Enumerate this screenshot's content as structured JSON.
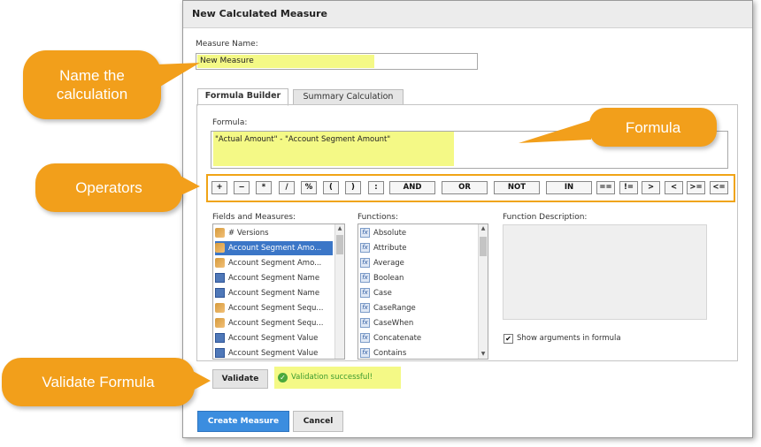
{
  "dialog": {
    "title": "New Calculated Measure",
    "measure_name_label": "Measure Name:",
    "measure_name_value": "New Measure",
    "tabs": [
      "Formula Builder",
      "Summary Calculation"
    ],
    "formula_label": "Formula:",
    "formula_value": "\"Actual Amount\" - \"Account Segment Amount\"",
    "operators": [
      "+",
      "−",
      "*",
      "/",
      "%",
      "(",
      ")",
      ":",
      "AND",
      "OR",
      "NOT",
      "IN",
      "==",
      "!=",
      ">",
      "<",
      ">=",
      "<="
    ],
    "fields_label": "Fields and Measures:",
    "fields": [
      {
        "label": "# Versions",
        "icon": "measure-icon"
      },
      {
        "label": "Account Segment Amo...",
        "icon": "measure-icon",
        "selected": true
      },
      {
        "label": "Account Segment Amo...",
        "icon": "measure-icon"
      },
      {
        "label": "Account Segment Name",
        "icon": "column-icon"
      },
      {
        "label": "Account Segment Name",
        "icon": "column-icon"
      },
      {
        "label": "Account Segment Sequ...",
        "icon": "measure-icon"
      },
      {
        "label": "Account Segment Sequ...",
        "icon": "measure-icon"
      },
      {
        "label": "Account Segment Value",
        "icon": "column-icon"
      },
      {
        "label": "Account Segment Value",
        "icon": "column-icon"
      }
    ],
    "functions_label": "Functions:",
    "functions": [
      "Absolute",
      "Attribute",
      "Average",
      "Boolean",
      "Case",
      "CaseRange",
      "CaseWhen",
      "Concatenate",
      "Contains"
    ],
    "function_description_label": "Function Description:",
    "show_arguments_label": "Show arguments in formula",
    "show_arguments_checked": true,
    "validate_label": "Validate",
    "validation_message": "Validation successful!",
    "create_label": "Create Measure",
    "cancel_label": "Cancel"
  },
  "callouts": {
    "name": "Name the calculation",
    "formula": "Formula",
    "operators": "Operators",
    "validate": "Validate Formula"
  },
  "colors": {
    "callout": "#f29f1b",
    "highlight": "#f4f986",
    "selection": "#3b76c7",
    "primary_button": "#3b8ddf",
    "success": "#4aa83c"
  }
}
